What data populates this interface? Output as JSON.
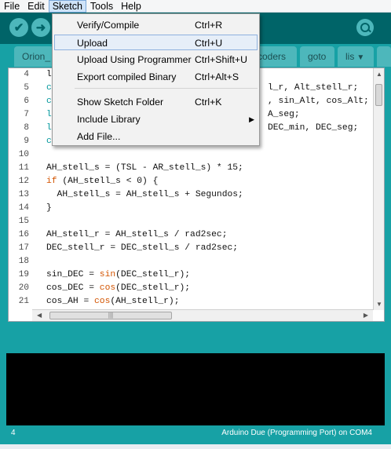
{
  "menubar": {
    "items": [
      "File",
      "Edit",
      "Sketch",
      "Tools",
      "Help"
    ]
  },
  "toolbar": {
    "verify_icon": "check-icon",
    "upload_icon": "arrow-right-icon",
    "serial_monitor_icon": "magnifier-icon"
  },
  "tabs": {
    "items": [
      "Orion_",
      "coders",
      "goto",
      "lis"
    ],
    "overflow_icon": "caret-down-icon"
  },
  "sketch_menu": {
    "items": [
      {
        "label": "Verify/Compile",
        "shortcut": "Ctrl+R"
      },
      {
        "label": "Upload",
        "shortcut": "Ctrl+U"
      },
      {
        "label": "Upload Using Programmer",
        "shortcut": "Ctrl+Shift+U"
      },
      {
        "label": "Export compiled Binary",
        "shortcut": "Ctrl+Alt+S"
      },
      {
        "label": "Show Sketch Folder",
        "shortcut": "Ctrl+K"
      },
      {
        "label": "Include Library",
        "shortcut": ""
      },
      {
        "label": "Add File...",
        "shortcut": ""
      }
    ],
    "highlighted": "Upload"
  },
  "editor": {
    "line_numbers": [
      "4",
      "5",
      "6",
      "7",
      "8",
      "9",
      "10",
      "11",
      "12",
      "13",
      "14",
      "15",
      "16",
      "17",
      "18",
      "19",
      "20",
      "21"
    ],
    "partial_lines": {
      "l4": "l",
      "l5a": "c",
      "l5b": "l_r, Alt_stell_r;",
      "l6a": "c",
      "l6b": ", sin_Alt, cos_Alt;",
      "l7a": "l",
      "l7b": "A_seg;",
      "l8a": "l",
      "l8b": "DEC_min, DEC_seg;",
      "l9": "c"
    },
    "lines": {
      "l11": "AH_stell_s = (TSL - AR_stell_s) * 15;",
      "l12_kw": "if",
      "l12_rest": " (AH_stell_s < 0) {",
      "l13": "  AH_stell_s = AH_stell_s + Segundos;",
      "l14": "}",
      "l16": "AH_stell_r = AH_stell_s / rad2sec;",
      "l17": "DEC_stell_r = DEC_stell_s / rad2sec;",
      "l19_a": "sin_DEC = ",
      "l19_fn": "sin",
      "l19_b": "(DEC_stell_r);",
      "l20_a": "cos_DEC = ",
      "l20_fn": "cos",
      "l20_b": "(DEC_stell_r);",
      "l21_a": "cos_AH = ",
      "l21_fn": "cos",
      "l21_b": "(AH_stell_r);"
    },
    "hscroll_grip": "|||"
  },
  "status": {
    "line": "4",
    "board": "Arduino Due (Programming Port) on COM4"
  }
}
